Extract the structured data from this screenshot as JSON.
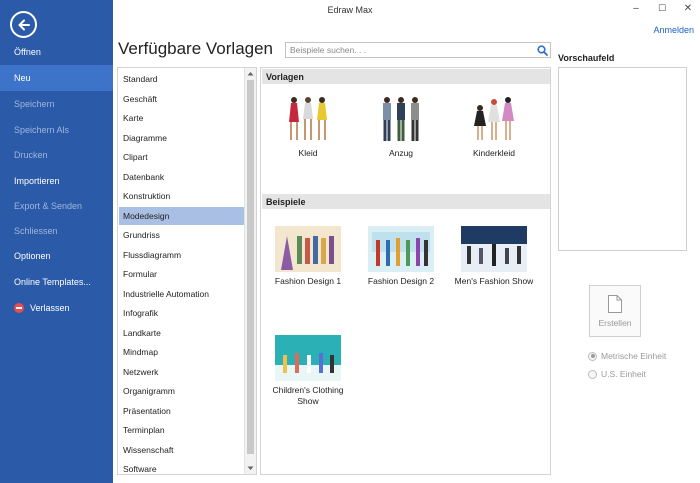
{
  "app_title": "Edraw Max",
  "signin_label": "Anmelden",
  "window_controls": {
    "minimize": "–",
    "maximize": "☐",
    "close": "✕"
  },
  "sidebar": {
    "items": [
      {
        "label": "Öffnen",
        "state": "normal"
      },
      {
        "label": "Neu",
        "state": "active"
      },
      {
        "label": "Speichern",
        "state": "disabled"
      },
      {
        "label": "Speichern Als",
        "state": "disabled"
      },
      {
        "label": "Drucken",
        "state": "disabled"
      },
      {
        "label": "Importieren",
        "state": "normal"
      },
      {
        "label": "Export & Senden",
        "state": "disabled"
      },
      {
        "label": "Schliessen",
        "state": "disabled"
      },
      {
        "label": "Optionen",
        "state": "normal"
      },
      {
        "label": "Online Templates...",
        "state": "normal"
      },
      {
        "label": "Verlassen",
        "state": "normal"
      }
    ]
  },
  "main": {
    "title": "Verfügbare Vorlagen",
    "search_placeholder": "Beispiele suchen. . .",
    "categories": [
      "Standard",
      "Geschäft",
      "Karte",
      "Diagramme",
      "Clipart",
      "Datenbank",
      "Konstruktion",
      "Modedesign",
      "Grundriss",
      "Flussdiagramm",
      "Formular",
      "Industrielle Automation",
      "Infografik",
      "Landkarte",
      "Mindmap",
      "Netzwerk",
      "Organigramm",
      "Präsentation",
      "Terminplan",
      "Wissenschaft",
      "Software"
    ],
    "selected_category": "Modedesign",
    "templates_section": "Vorlagen",
    "templates": [
      {
        "label": "Kleid"
      },
      {
        "label": "Anzug"
      },
      {
        "label": "Kinderkleid"
      }
    ],
    "examples_section": "Beispiele",
    "examples": [
      {
        "label": "Fashion Design 1"
      },
      {
        "label": "Fashion Design 2"
      },
      {
        "label": "Men's Fashion Show"
      },
      {
        "label": "Children's Clothing Show"
      }
    ]
  },
  "preview": {
    "label": "Vorschaufeld",
    "create_label": "Erstellen",
    "units": [
      {
        "label": "Metrische Einheit",
        "checked": true
      },
      {
        "label": "U.S. Einheit",
        "checked": false
      }
    ]
  },
  "colors": {
    "sidebar": "#2b5aa8",
    "sidebar_active": "#3d73c9",
    "selection": "#a9bfe3",
    "link": "#1e5fc9",
    "quit": "#e84c4c"
  }
}
